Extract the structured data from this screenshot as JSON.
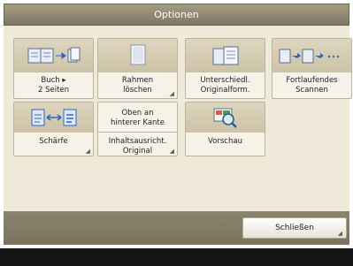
{
  "window": {
    "title": "Optionen"
  },
  "tiles": [
    {
      "label": "Buch ▸\n2 Seiten",
      "icon": "book-to-two-pages-icon"
    },
    {
      "label": "Rahmen\nlöschen",
      "icon": "erase-frame-icon"
    },
    {
      "label": "Unterschiedl.\nOriginalform.",
      "icon": "different-originals-icon"
    },
    {
      "label": "Fortlaufendes\nScannen",
      "icon": "continuous-scan-icon"
    },
    {
      "label": "Schärfe",
      "icon": "sharpness-icon"
    },
    {
      "top_label": "Oben an\nhinterer Kante",
      "label": "Inhaltsausricht.\nOriginal"
    },
    {
      "label": "Vorschau",
      "icon": "preview-icon"
    }
  ],
  "footer": {
    "close_label": "Schließen"
  },
  "colors": {
    "accent": "#2f63c7",
    "title_bar": "#8f8870",
    "panel": "#efe9da"
  }
}
